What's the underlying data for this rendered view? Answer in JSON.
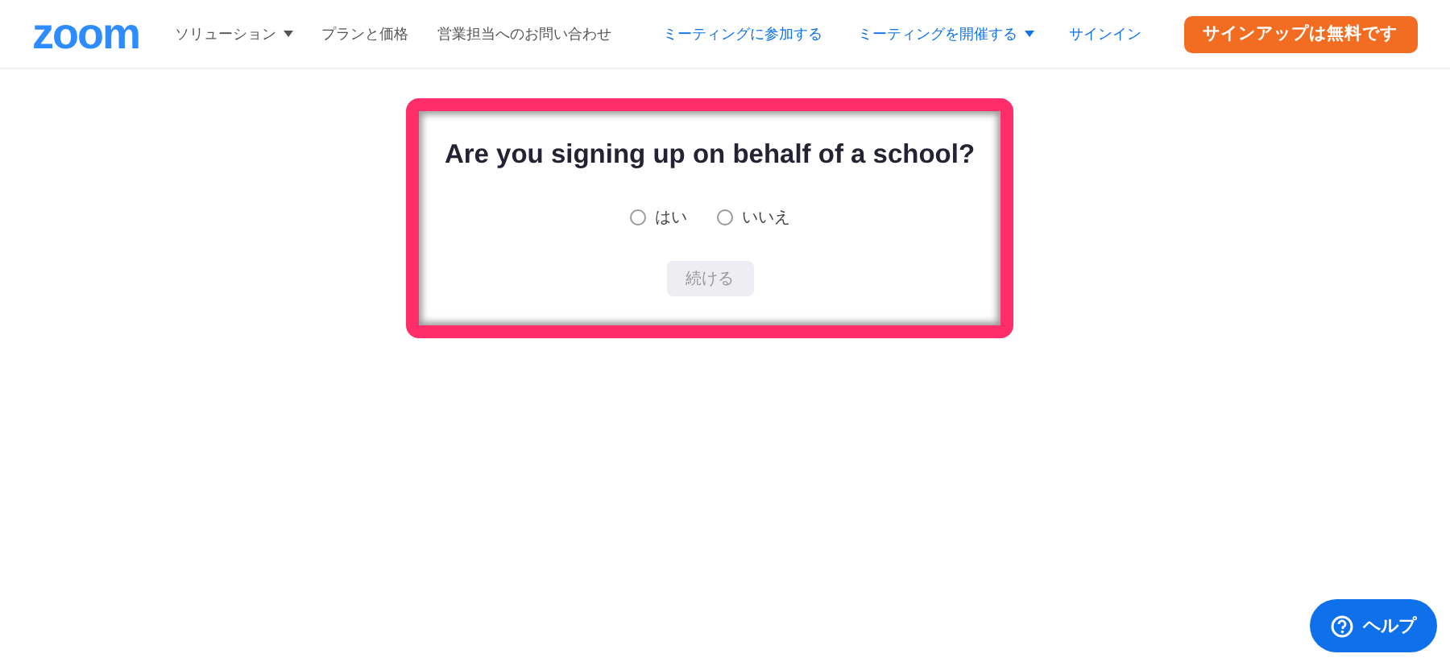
{
  "header": {
    "logo": "zoom",
    "left_nav": [
      {
        "label": "ソリューション",
        "dropdown": true
      },
      {
        "label": "プランと価格",
        "dropdown": false
      },
      {
        "label": "営業担当へのお問い合わせ",
        "dropdown": false
      }
    ],
    "right_nav": [
      {
        "label": "ミーティングに参加する",
        "dropdown": false
      },
      {
        "label": "ミーティングを開催する",
        "dropdown": true
      },
      {
        "label": "サインイン",
        "dropdown": false
      }
    ],
    "signup_button": "サインアップは無料です"
  },
  "dialog": {
    "question": "Are you signing up on behalf of a school?",
    "options": [
      {
        "label": "はい",
        "selected": false
      },
      {
        "label": "いいえ",
        "selected": false
      }
    ],
    "continue_button": {
      "label": "続ける",
      "disabled": true
    }
  },
  "help_button": "ヘルプ"
}
